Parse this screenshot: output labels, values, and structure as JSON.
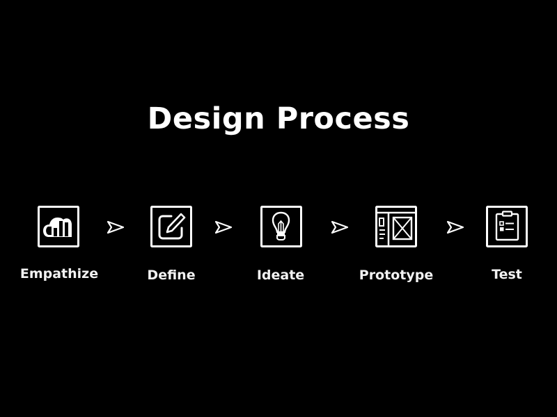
{
  "title": "Design Process",
  "colors": {
    "background": "#000000",
    "foreground": "#ffffff"
  },
  "steps": [
    {
      "label": "Empathize",
      "icon": "heart-bar-chart-icon"
    },
    {
      "label": "Define",
      "icon": "edit-pencil-icon"
    },
    {
      "label": "Ideate",
      "icon": "lightbulb-icon"
    },
    {
      "label": "Prototype",
      "icon": "wireframe-layout-icon"
    },
    {
      "label": "Test",
      "icon": "clipboard-checklist-icon"
    }
  ],
  "connector_icon": "arrow-right-icon"
}
